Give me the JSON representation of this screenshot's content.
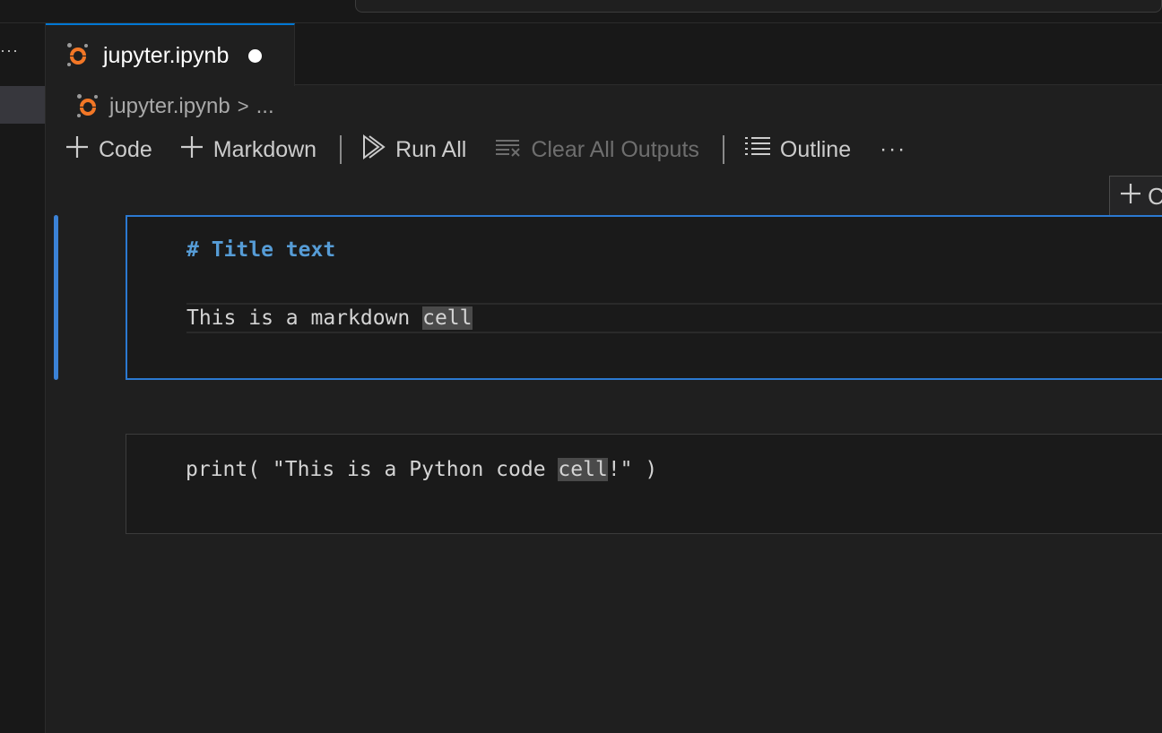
{
  "tab": {
    "label": "jupyter.ipynb"
  },
  "breadcrumb": {
    "file": "jupyter.ipynb",
    "separator": ">",
    "tail": "..."
  },
  "toolbar": {
    "code_label": "Code",
    "markdown_label": "Markdown",
    "run_all_label": "Run All",
    "clear_outputs_label": "Clear All Outputs",
    "outline_label": "Outline",
    "more_label": "···"
  },
  "float_add": {
    "label": "C"
  },
  "cells": {
    "markdown": {
      "heading": "# Title text",
      "text_before": "This is a markdown ",
      "text_highlight": "cell"
    },
    "code": {
      "before": "print( \"This is a Python code ",
      "highlight": "cell",
      "after": "!\" )"
    }
  },
  "colors": {
    "accent": "#0078d4",
    "jupyter_orange": "#f37726",
    "heading_blue": "#569cd6"
  }
}
